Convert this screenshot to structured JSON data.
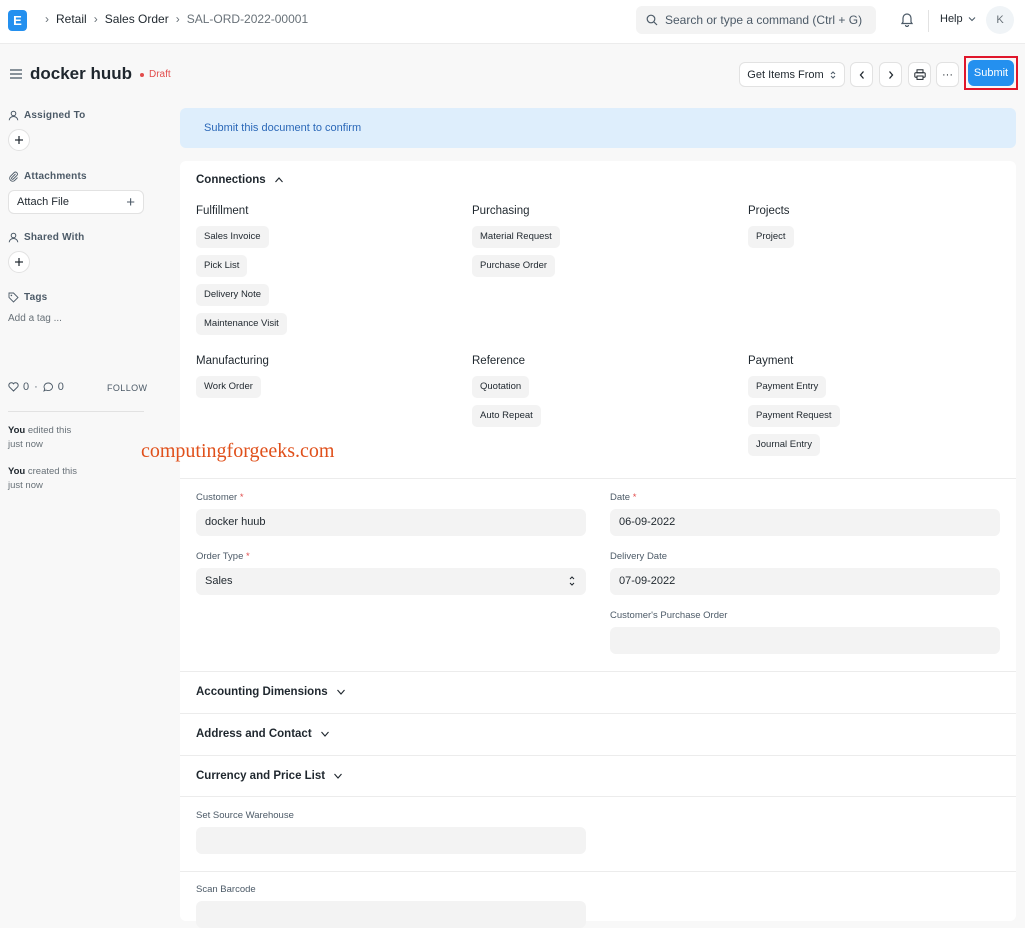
{
  "navbar": {
    "breadcrumbs": [
      "Retail",
      "Sales Order",
      "SAL-ORD-2022-00001"
    ],
    "search_placeholder": "Search or type a command (Ctrl + G)",
    "help_label": "Help",
    "avatar_initial": "K"
  },
  "header": {
    "title": "docker huub",
    "status": "Draft",
    "get_items_label": "Get Items From",
    "more_label": "···",
    "submit_label": "Submit"
  },
  "sidebar": {
    "assigned_to": "Assigned To",
    "attachments": "Attachments",
    "attach_file": "Attach File",
    "shared_with": "Shared With",
    "tags": "Tags",
    "add_tag": "Add a tag ...",
    "likes": "0",
    "comments": "0",
    "follow": "FOLLOW",
    "activity": [
      {
        "who": "You",
        "text": " edited this",
        "when": "just now"
      },
      {
        "who": "You",
        "text": " created this",
        "when": "just now"
      }
    ]
  },
  "alert": "Submit this document to confirm",
  "connections": {
    "title": "Connections",
    "groups": [
      {
        "title": "Fulfillment",
        "items": [
          "Sales Invoice",
          "Pick List",
          "Delivery Note",
          "Maintenance Visit"
        ]
      },
      {
        "title": "Purchasing",
        "items": [
          "Material Request",
          "Purchase Order"
        ]
      },
      {
        "title": "Projects",
        "items": [
          "Project"
        ]
      },
      {
        "title": "Manufacturing",
        "items": [
          "Work Order"
        ]
      },
      {
        "title": "Reference",
        "items": [
          "Quotation",
          "Auto Repeat"
        ]
      },
      {
        "title": "Payment",
        "items": [
          "Payment Entry",
          "Payment Request",
          "Journal Entry"
        ]
      }
    ]
  },
  "watermark": "computingforgeeks.com",
  "form": {
    "customer_label": "Customer",
    "customer_value": "docker huub",
    "date_label": "Date",
    "date_value": "06-09-2022",
    "order_type_label": "Order Type",
    "order_type_value": "Sales",
    "delivery_date_label": "Delivery Date",
    "delivery_date_value": "07-09-2022",
    "po_label": "Customer's Purchase Order",
    "po_value": ""
  },
  "sections": {
    "accounting": "Accounting Dimensions",
    "address": "Address and Contact",
    "currency": "Currency and Price List"
  },
  "warehouse": {
    "source_label": "Set Source Warehouse",
    "scan_label": "Scan Barcode"
  },
  "colors": {
    "primary": "#2490ef",
    "draft": "#e24c4c",
    "alert_bg": "#deeefc",
    "highlight_border": "#e0162b",
    "watermark": "#e0501b"
  }
}
